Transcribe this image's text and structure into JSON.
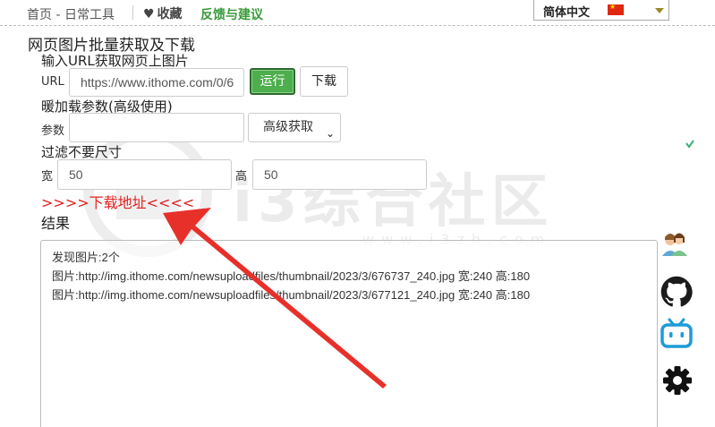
{
  "nav": {
    "home": "首页 - 日常工具",
    "favorite": "收藏",
    "feedback": "反馈与建议",
    "language": "简体中文"
  },
  "page": {
    "title": "网页图片批量获取及下载",
    "url_section": "输入URL获取网页上图片",
    "url_label": "URL",
    "url_value": "https://www.ithome.com/0/6",
    "run_button": "运行",
    "download_button": "下载",
    "params_section": "暖加载参数(高级使用)",
    "params_label": "参数",
    "params_value": "",
    "mode_select": "高级获取",
    "filter_section": "过滤不要尺寸",
    "width_label": "宽",
    "width_value": "50",
    "height_label": "高",
    "height_value": "50",
    "download_link": ">>>>下载地址<<<<",
    "results_label": "结果"
  },
  "results": {
    "lines": [
      "发现图片:2个",
      "图片:http://img.ithome.com/newsuploadfiles/thumbnail/2023/3/676737_240.jpg 宽:240 高:180",
      "图片:http://img.ithome.com/newsuploadfiles/thumbnail/2023/3/677121_240.jpg 宽:240 高:180"
    ]
  },
  "watermark": {
    "text": "i3综合社区",
    "url": "www.i3zh.com"
  },
  "icons": {
    "favorite": "heart-icon",
    "flag": "china-flag-icon",
    "side": [
      "users-icon",
      "github-icon",
      "bilibili-icon",
      "settings-icon"
    ]
  },
  "colors": {
    "run_button": "#4cae4c",
    "feedback": "#3a9a3a",
    "download_link": "#e0201f",
    "arrow": "#e8302a"
  }
}
